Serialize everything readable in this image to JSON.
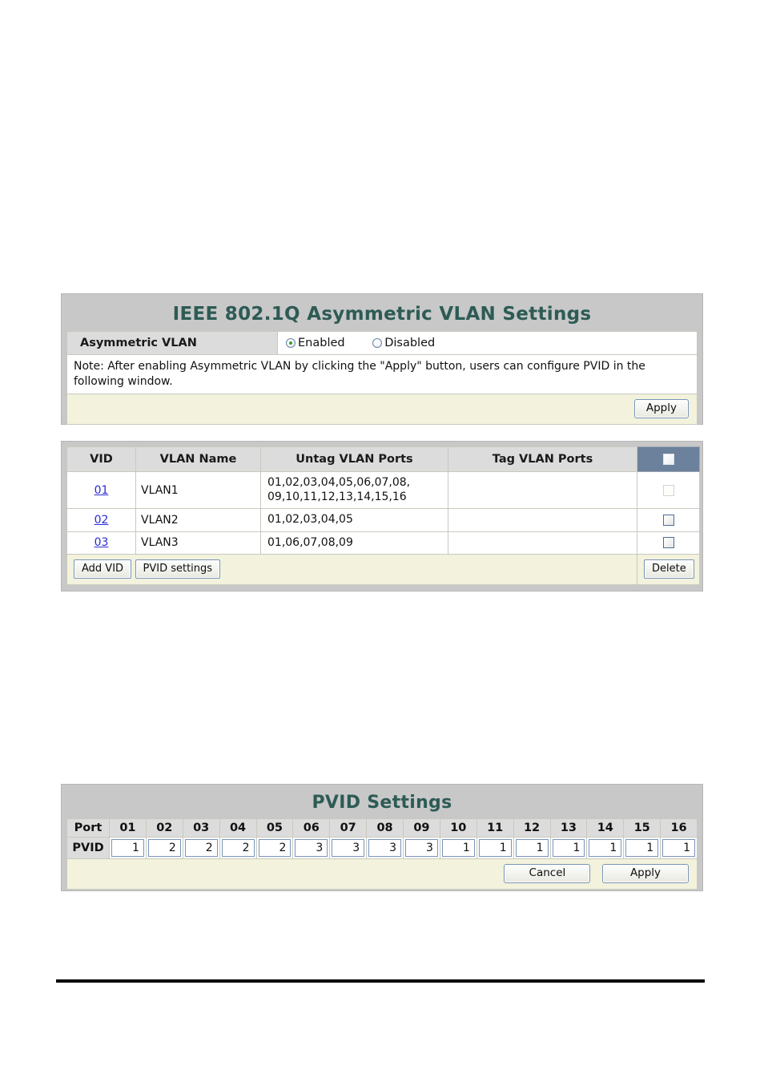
{
  "asymmetric_panel": {
    "title": "IEEE 802.1Q Asymmetric VLAN Settings",
    "field_label": "Asymmetric VLAN",
    "options": [
      {
        "label": "Enabled",
        "selected": true
      },
      {
        "label": "Disabled",
        "selected": false
      }
    ],
    "note": "Note: After enabling Asymmetric VLAN by clicking the \"Apply\" button, users can configure PVID in the following window.",
    "apply_label": "Apply"
  },
  "vlan_table": {
    "headers": [
      "VID",
      "VLAN Name",
      "Untag VLAN Ports",
      "Tag VLAN Ports"
    ],
    "rows": [
      {
        "vid": "01",
        "name": "VLAN1",
        "untag_ports": "01,02,03,04,05,06,07,08,\n09,10,11,12,13,14,15,16",
        "tag_ports": "",
        "checkbox_state": "disabled"
      },
      {
        "vid": "02",
        "name": "VLAN2",
        "untag_ports": "01,02,03,04,05",
        "tag_ports": "",
        "checkbox_state": "enabled"
      },
      {
        "vid": "03",
        "name": "VLAN3",
        "untag_ports": "01,06,07,08,09",
        "tag_ports": "",
        "checkbox_state": "enabled"
      }
    ],
    "add_vid_label": "Add VID",
    "pvid_settings_label": "PVID settings",
    "delete_label": "Delete"
  },
  "pvid_panel": {
    "title": "PVID Settings",
    "port_row_label": "Port",
    "pvid_row_label": "PVID",
    "ports": [
      "01",
      "02",
      "03",
      "04",
      "05",
      "06",
      "07",
      "08",
      "09",
      "10",
      "11",
      "12",
      "13",
      "14",
      "15",
      "16"
    ],
    "pvid_values": [
      "1",
      "2",
      "2",
      "2",
      "2",
      "3",
      "3",
      "3",
      "3",
      "1",
      "1",
      "1",
      "1",
      "1",
      "1",
      "1"
    ],
    "cancel_label": "Cancel",
    "apply_label": "Apply"
  },
  "colors": {
    "panel_frame": "#c8c8c8",
    "title_text": "#2d5b55",
    "header_cell": "#dcdcdc",
    "check_header": "#6c819b",
    "action_bar": "#f2f2dd",
    "link": "#2b2bd4",
    "radio_selected": "#2fa32f"
  }
}
